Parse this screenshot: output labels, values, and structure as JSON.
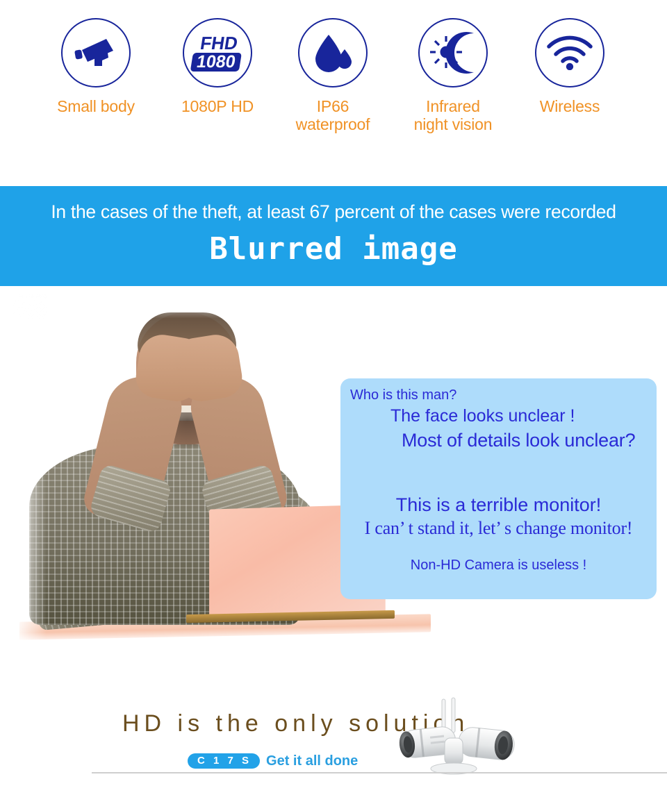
{
  "features": [
    {
      "icon": "cctv-camera-icon",
      "label": "Small body"
    },
    {
      "icon": "fhd-1080-icon",
      "label": "1080P HD",
      "badge_top": "FHD",
      "badge_bottom": "1080"
    },
    {
      "icon": "water-drop-icon",
      "label": "IP66\nwaterproof"
    },
    {
      "icon": "sun-moon-icon",
      "label": "Infrared\nnight vision"
    },
    {
      "icon": "wifi-icon",
      "label": "Wireless"
    }
  ],
  "banner": {
    "line1": "In the cases of the theft, at least 67 percent of the cases were recorded",
    "line2": "Blurred image",
    "bg_color": "#1FA2E8",
    "text_color": "#FFFFFF"
  },
  "quote_box": {
    "bg_color": "#AEDCFB",
    "text_color": "#2A2AD6",
    "lines": [
      "Who is this man?",
      "The face looks unclear !",
      "Most of details look unclear?",
      "This is a terrible monitor!",
      "I can’  t stand it, let’  s change monitor!",
      "Non-HD Camera is useless !"
    ]
  },
  "bottom": {
    "headline": "HD is the only solution",
    "headline_color": "#6B4E1E",
    "model_badge": "C 1 7 S",
    "tagline": "Get it all done",
    "tagline_color": "#2A9FE0",
    "product_image": "wireless-bullet-camera-pair"
  },
  "colors": {
    "brand_blue": "#18259B",
    "accent_orange": "#F09226",
    "sky_blue": "#1FA2E8",
    "light_blue": "#AEDCFB"
  }
}
